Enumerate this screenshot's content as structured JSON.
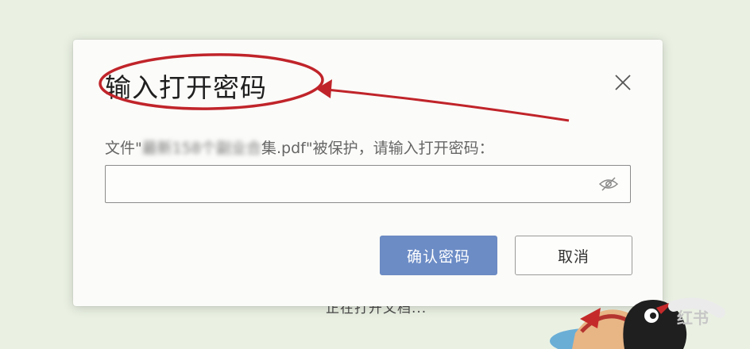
{
  "background": {
    "status_text": "正在打开文档..."
  },
  "dialog": {
    "title": "输入打开密码",
    "prompt_prefix": "文件\"",
    "prompt_filename_obscured": "最新158个副业合",
    "prompt_filename_suffix": "集.pdf",
    "prompt_suffix": "\"被保护，请输入打开密码：",
    "password_value": "",
    "confirm_label": "确认密码",
    "cancel_label": "取消",
    "close_icon": "close-icon",
    "visibility_icon": "eye-slash-icon"
  },
  "annotation": {
    "shape": "red-ellipse-with-arrow",
    "color": "#c0242a"
  },
  "watermark": {
    "text": "红书"
  },
  "colors": {
    "accent": "#6c8cc6",
    "annotation_red": "#c0242a"
  }
}
